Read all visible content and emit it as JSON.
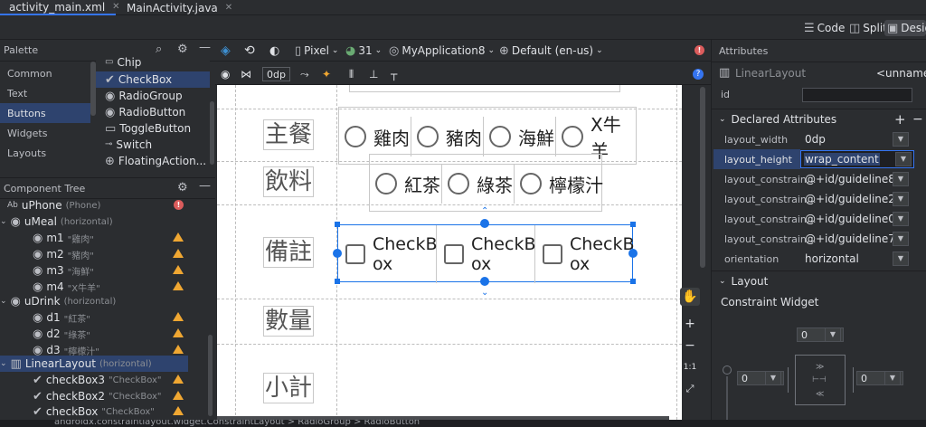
{
  "tabs": [
    {
      "label": "activity_main.xml",
      "icon": "xml-file-icon",
      "active": true
    },
    {
      "label": "MainActivity.java",
      "icon": "java-class-icon",
      "active": false
    }
  ],
  "modes": {
    "code": "Code",
    "split": "Split",
    "design": "Desig"
  },
  "palette": {
    "title": "Palette",
    "categories": [
      "Common",
      "Text",
      "Buttons",
      "Widgets",
      "Layouts"
    ],
    "selected_category": "Buttons",
    "items": [
      "Chip",
      "CheckBox",
      "RadioGroup",
      "RadioButton",
      "ToggleButton",
      "Switch",
      "FloatingAction..."
    ],
    "selected_item": "CheckBox"
  },
  "tree": {
    "title": "Component Tree",
    "nodes": [
      {
        "name": "uPhone",
        "sub": "(Phone)"
      },
      {
        "name": "uMeal",
        "sub": "(horizontal)"
      },
      {
        "name": "m1",
        "sub": "\"雞肉\""
      },
      {
        "name": "m2",
        "sub": "\"豬肉\""
      },
      {
        "name": "m3",
        "sub": "\"海鮮\""
      },
      {
        "name": "m4",
        "sub": "\"X牛羊\""
      },
      {
        "name": "uDrink",
        "sub": "(horizontal)"
      },
      {
        "name": "d1",
        "sub": "\"紅茶\""
      },
      {
        "name": "d2",
        "sub": "\"綠茶\""
      },
      {
        "name": "d3",
        "sub": "\"檸檬汁\""
      },
      {
        "name": "LinearLayout",
        "sub": "(horizontal)"
      },
      {
        "name": "checkBox3",
        "sub": "\"CheckBox\""
      },
      {
        "name": "checkBox2",
        "sub": "\"CheckBox\""
      },
      {
        "name": "checkBox",
        "sub": "\"CheckBox\""
      }
    ]
  },
  "toolbar": {
    "device": "Pixel",
    "api": "31",
    "app": "MyApplication8",
    "locale": "Default (en-us)",
    "margin": "0dp"
  },
  "design": {
    "labels": [
      "主餐",
      "飲料",
      "備註",
      "數量",
      "小計"
    ],
    "meal_options": [
      "雞肉",
      "豬肉",
      "海鮮",
      "X牛羊"
    ],
    "drink_options": [
      "紅茶",
      "綠茶",
      "檸檬汁"
    ],
    "checkbox_label": "CheckBox",
    "checkbox_line1": "CheckB",
    "checkbox_line2": "ox"
  },
  "attributes": {
    "title": "Attributes",
    "widget_type": "LinearLayout",
    "widget_name": "<unnamed",
    "id_label": "id",
    "declared_title": "Declared Attributes",
    "rows": [
      {
        "name": "layout_width",
        "value": "0dp"
      },
      {
        "name": "layout_height",
        "value": "wrap_content"
      },
      {
        "name": "layout_constrain...",
        "value": "@+id/guideline8"
      },
      {
        "name": "layout_constrain...",
        "value": "@+id/guideline2"
      },
      {
        "name": "layout_constrain...",
        "value": "@+id/guideline0"
      },
      {
        "name": "layout_constrain...",
        "value": "@+id/guideline7"
      },
      {
        "name": "orientation",
        "value": "horizontal"
      }
    ],
    "layout_title": "Layout",
    "constraint_widget": "Constraint Widget",
    "margins": {
      "top": "0",
      "left": "0",
      "right": "0"
    }
  },
  "statusbar": {
    "breadcrumb": "androidx.constraintlayout.widget.ConstraintLayout  >  RadioGroup  >  RadioButton"
  },
  "colors": {
    "accent": "#3574f0",
    "selection": "#2e436e",
    "warning": "#f0a732",
    "error": "#db5c5c",
    "handle": "#1a73e8"
  }
}
